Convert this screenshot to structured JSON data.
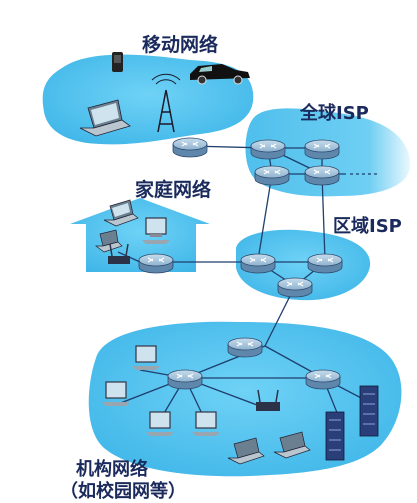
{
  "labels": {
    "mobile_network": "移动网络",
    "global_isp": "全球ISP",
    "home_network": "家庭网络",
    "regional_isp": "区域ISP",
    "institutional_line1": "机构网络",
    "institutional_line2": "（如校园网等）"
  },
  "colors": {
    "cloud": "#5cc6ef",
    "cloud_edge": "#7fd3f3",
    "router": "#8fb7d4",
    "link": "#1f3f6e",
    "label": "#1a2a5c",
    "server": "#2a3f7a"
  },
  "icons": [
    "laptop-icon",
    "phone-icon",
    "car-icon",
    "cell-tower-icon",
    "desktop-icon",
    "wireless-router-icon",
    "server-rack-icon",
    "router-icon"
  ]
}
